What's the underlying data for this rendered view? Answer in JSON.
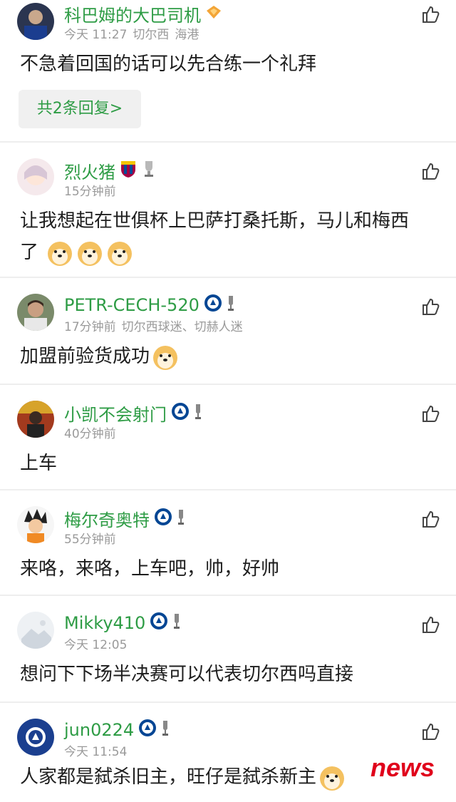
{
  "comments": [
    {
      "name": "科巴姆的大巴司机",
      "time": "今天 11:27",
      "team": "切尔西",
      "location": "海港",
      "text": "不急着回国的话可以先合练一个礼拜",
      "replies": "共2条回复>"
    },
    {
      "name": "烈火猪",
      "time": "15分钟前",
      "text_line1": "让我想起在世俱杯上巴萨打桑托斯，马儿和梅西",
      "text_line2": "了"
    },
    {
      "name": "PETR-CECH-520",
      "time": "17分钟前",
      "team": "切尔西球迷、切赫人迷",
      "text": "加盟前验货成功"
    },
    {
      "name": "小凯不会射门",
      "time": "40分钟前",
      "text": "上车"
    },
    {
      "name": "梅尔奇奥特",
      "time": "55分钟前",
      "text": "来咯，来咯，上车吧，帅，好帅"
    },
    {
      "name": "Mikky410",
      "time": "今天 12:05",
      "text": "想问下下场半决赛可以代表切尔西吗直接"
    },
    {
      "name": "jun0224",
      "time": "今天 11:54",
      "text": "人家都是弑杀旧主，旺仔是弑杀新主"
    }
  ],
  "icons": {
    "like": "thumbs-up-icon",
    "club_badge": "chelsea-badge-icon",
    "trophy": "trophy-icon",
    "vip": "vip-diamond-icon",
    "emoji": "doge-emoji"
  },
  "colors": {
    "username": "#2e9c45",
    "meta": "#9a9a9a",
    "divider": "#eeeeee",
    "watermark": "#e0001b"
  },
  "watermark": "news"
}
